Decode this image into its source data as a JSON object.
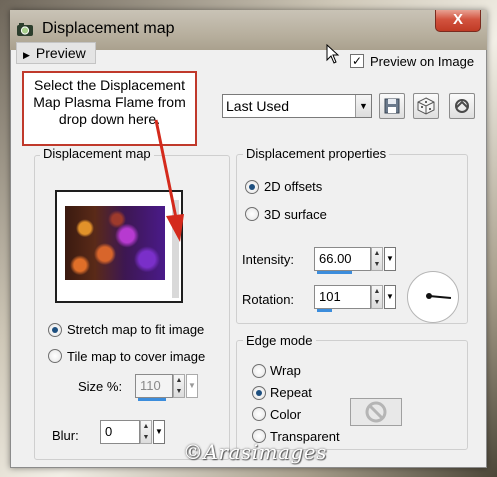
{
  "window": {
    "title": "Displacement map",
    "close_label": "X"
  },
  "preview": {
    "toggle_label": "Preview",
    "on_image_label": "Preview on Image",
    "on_image_checked": true
  },
  "callout": {
    "text": "Select the Displacement Map Plasma Flame from drop down here."
  },
  "presets": {
    "selected": "Last Used"
  },
  "displacement_map": {
    "group_title": "Displacement map",
    "stretch_label": "Stretch map to fit image",
    "tile_label": "Tile map to cover image",
    "selected_mode": "stretch",
    "size_label": "Size %:",
    "size_value": "110",
    "blur_label": "Blur:",
    "blur_value": "0"
  },
  "properties": {
    "group_title": "Displacement properties",
    "offsets_label": "2D offsets",
    "surface_label": "3D surface",
    "selected": "2d",
    "intensity_label": "Intensity:",
    "intensity_value": "66.00",
    "intensity_fill": 0.66,
    "rotation_label": "Rotation:",
    "rotation_value": "101",
    "rotation_fill": 0.28
  },
  "edge_mode": {
    "group_title": "Edge mode",
    "options": [
      "Wrap",
      "Repeat",
      "Color",
      "Transparent"
    ],
    "selected": "Repeat"
  },
  "watermark": "©Arasimages",
  "colors": {
    "accent": "#3c8ddc",
    "callout_border": "#c0392b",
    "close": "#c9432c"
  }
}
